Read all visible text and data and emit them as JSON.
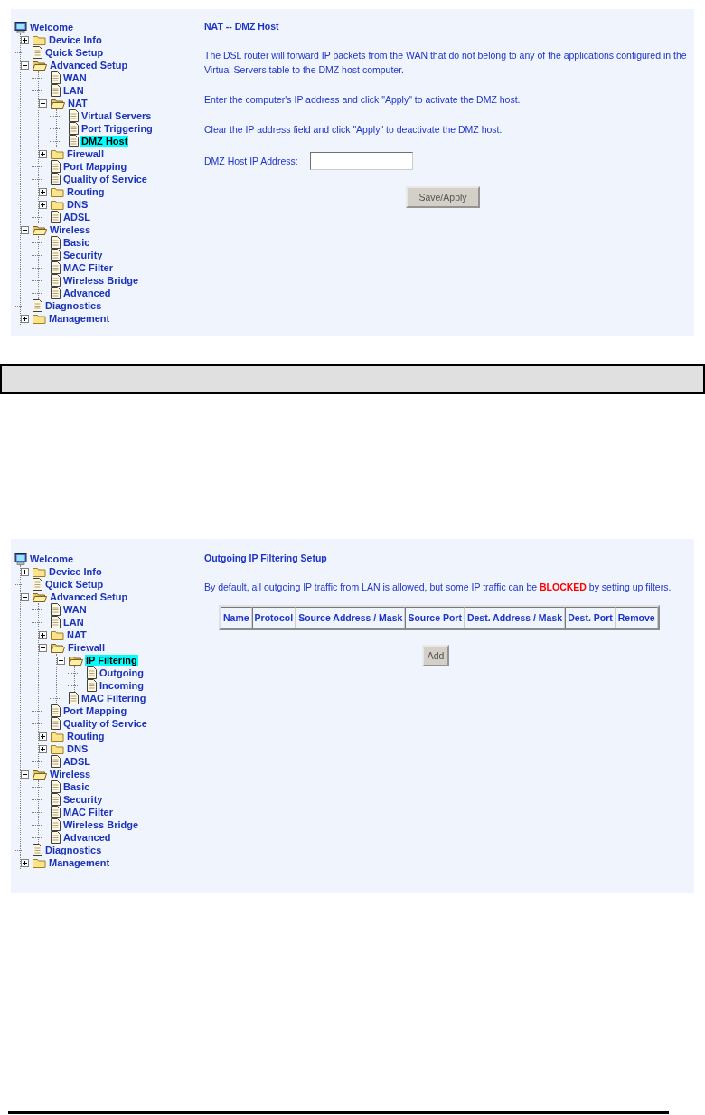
{
  "screens": [
    {
      "tree": {
        "label": "Welcome",
        "kind": "root",
        "children": [
          {
            "label": "Device Info",
            "kind": "folder",
            "expanded": false,
            "selected": false
          },
          {
            "label": "Quick Setup",
            "kind": "page",
            "selected": false
          },
          {
            "label": "Advanced Setup",
            "kind": "folder",
            "expanded": true,
            "selected": false,
            "children": [
              {
                "label": "WAN",
                "kind": "page",
                "selected": false
              },
              {
                "label": "LAN",
                "kind": "page",
                "selected": false
              },
              {
                "label": "NAT",
                "kind": "folder",
                "expanded": true,
                "selected": false,
                "children": [
                  {
                    "label": "Virtual Servers",
                    "kind": "page",
                    "selected": false
                  },
                  {
                    "label": "Port Triggering",
                    "kind": "page",
                    "selected": false
                  },
                  {
                    "label": "DMZ Host",
                    "kind": "page",
                    "selected": true
                  }
                ]
              },
              {
                "label": "Firewall",
                "kind": "folder",
                "expanded": false,
                "selected": false
              },
              {
                "label": "Port Mapping",
                "kind": "page",
                "selected": false
              },
              {
                "label": "Quality of Service",
                "kind": "page",
                "selected": false
              },
              {
                "label": "Routing",
                "kind": "folder",
                "expanded": false,
                "selected": false
              },
              {
                "label": "DNS",
                "kind": "folder",
                "expanded": false,
                "selected": false
              },
              {
                "label": "ADSL",
                "kind": "page",
                "selected": false
              }
            ]
          },
          {
            "label": "Wireless",
            "kind": "folder",
            "expanded": true,
            "selected": false,
            "children": [
              {
                "label": "Basic",
                "kind": "page",
                "selected": false
              },
              {
                "label": "Security",
                "kind": "page",
                "selected": false
              },
              {
                "label": "MAC Filter",
                "kind": "page",
                "selected": false
              },
              {
                "label": "Wireless Bridge",
                "kind": "page",
                "selected": false
              },
              {
                "label": "Advanced",
                "kind": "page",
                "selected": false
              }
            ]
          },
          {
            "label": "Diagnostics",
            "kind": "page",
            "selected": false
          },
          {
            "label": "Management",
            "kind": "folder",
            "expanded": false,
            "selected": false
          }
        ]
      },
      "content": {
        "title": "NAT -- DMZ Host",
        "paragraphs": [
          "The DSL router will forward IP packets from the WAN that do not belong to any of the applications configured in the Virtual Servers table to the DMZ host computer.",
          "Enter the computer's IP address and click \"Apply\" to activate the DMZ host.",
          "Clear the IP address field and click \"Apply\" to deactivate the DMZ host."
        ],
        "field": {
          "label": "DMZ Host IP Address:"
        },
        "button": "Save/Apply"
      }
    },
    {
      "tree": {
        "label": "Welcome",
        "kind": "root",
        "children": [
          {
            "label": "Device Info",
            "kind": "folder",
            "expanded": false,
            "selected": false
          },
          {
            "label": "Quick Setup",
            "kind": "page",
            "selected": false
          },
          {
            "label": "Advanced Setup",
            "kind": "folder",
            "expanded": true,
            "selected": false,
            "children": [
              {
                "label": "WAN",
                "kind": "page",
                "selected": false
              },
              {
                "label": "LAN",
                "kind": "page",
                "selected": false
              },
              {
                "label": "NAT",
                "kind": "folder",
                "expanded": false,
                "selected": false
              },
              {
                "label": "Firewall",
                "kind": "folder",
                "expanded": true,
                "selected": false,
                "children": [
                  {
                    "label": "IP Filtering",
                    "kind": "folder",
                    "expanded": true,
                    "selected": true,
                    "children": [
                      {
                        "label": "Outgoing",
                        "kind": "page",
                        "selected": false
                      },
                      {
                        "label": "Incoming",
                        "kind": "page",
                        "selected": false
                      }
                    ]
                  },
                  {
                    "label": "MAC Filtering",
                    "kind": "page",
                    "selected": false
                  }
                ]
              },
              {
                "label": "Port Mapping",
                "kind": "page",
                "selected": false
              },
              {
                "label": "Quality of Service",
                "kind": "page",
                "selected": false
              },
              {
                "label": "Routing",
                "kind": "folder",
                "expanded": false,
                "selected": false
              },
              {
                "label": "DNS",
                "kind": "folder",
                "expanded": false,
                "selected": false
              },
              {
                "label": "ADSL",
                "kind": "page",
                "selected": false
              }
            ]
          },
          {
            "label": "Wireless",
            "kind": "folder",
            "expanded": true,
            "selected": false,
            "children": [
              {
                "label": "Basic",
                "kind": "page",
                "selected": false
              },
              {
                "label": "Security",
                "kind": "page",
                "selected": false
              },
              {
                "label": "MAC Filter",
                "kind": "page",
                "selected": false
              },
              {
                "label": "Wireless Bridge",
                "kind": "page",
                "selected": false
              },
              {
                "label": "Advanced",
                "kind": "page",
                "selected": false
              }
            ]
          },
          {
            "label": "Diagnostics",
            "kind": "page",
            "selected": false
          },
          {
            "label": "Management",
            "kind": "folder",
            "expanded": false,
            "selected": false
          }
        ]
      },
      "content": {
        "title": "Outgoing IP Filtering Setup",
        "paragraphs": [
          "By default, all outgoing IP traffic from LAN is allowed, but some IP traffic can be **BLOCKED** by setting up filters."
        ],
        "table": {
          "columns": [
            "Name",
            "Protocol",
            "Source Address / Mask",
            "Source Port",
            "Dest. Address / Mask",
            "Dest. Port",
            "Remove"
          ]
        },
        "button": "Add"
      }
    }
  ]
}
